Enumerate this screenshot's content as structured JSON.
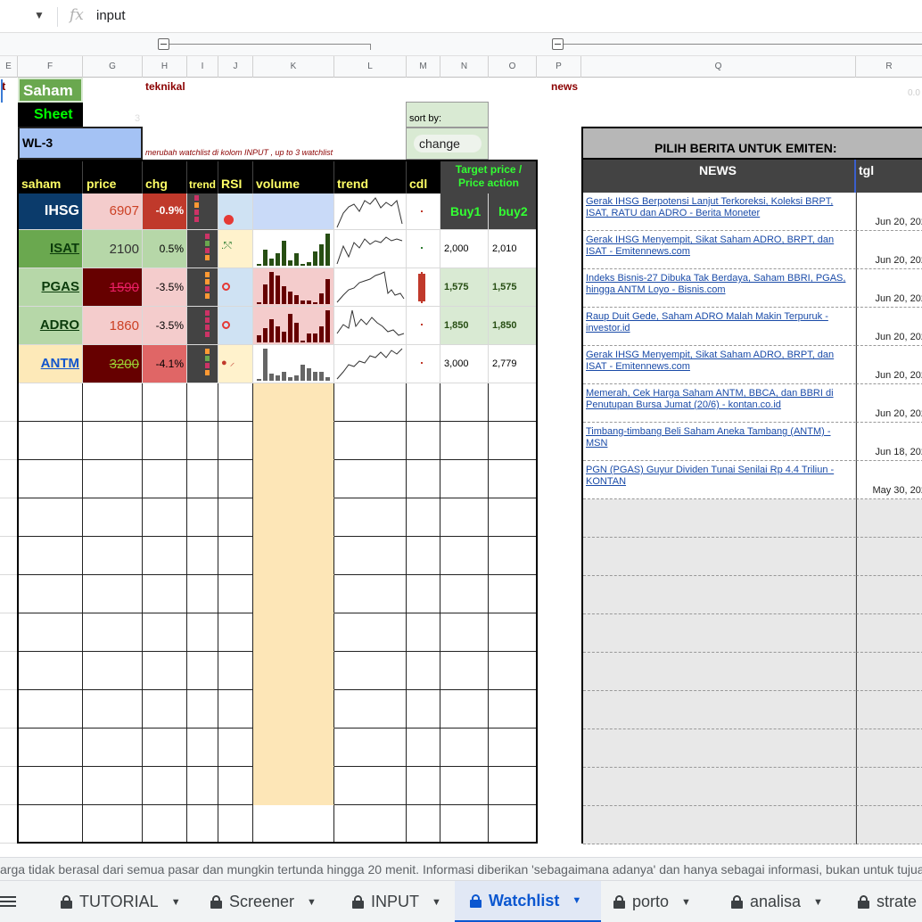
{
  "formula_bar": {
    "fx": "fx",
    "value": "input"
  },
  "columns": [
    "E",
    "F",
    "G",
    "H",
    "I",
    "J",
    "K",
    "L",
    "M",
    "N",
    "O",
    "P",
    "Q",
    "R"
  ],
  "sheet": {
    "corner_text": "t",
    "logo_line1": "Saham",
    "logo_line2": "Sheet",
    "stray_number": "3",
    "teknikal_label": "teknikal",
    "news_label": "news",
    "sort_by_label": "sort by:",
    "sort_value": "change",
    "watchlist_name": "WL-3",
    "watchlist_note": "merubah watchlist di kolom INPUT , up to 3 watchlist",
    "right_stray": "0.0",
    "headers": {
      "saham": "saham",
      "price": "price",
      "chg": "chg",
      "trend_small": "trend",
      "rsi": "RSI",
      "volume": "volume",
      "trend": "trend",
      "cdl": "cdl",
      "target": "Target price / Price action",
      "buy1": "Buy1",
      "buy2": "buy2"
    },
    "rows": [
      {
        "saham": "IHSG",
        "price": "6907",
        "chg": "-0.9%",
        "buy1": "",
        "buy2": "",
        "price_strike": false
      },
      {
        "saham": "ISAT",
        "price": "2100",
        "chg": "0.5%",
        "buy1": "2,000",
        "buy2": "2,010",
        "price_strike": false
      },
      {
        "saham": "PGAS",
        "price": "1590",
        "chg": "-3.5%",
        "buy1": "1,575",
        "buy2": "1,575",
        "price_strike": true
      },
      {
        "saham": "ADRO",
        "price": "1860",
        "chg": "-3.5%",
        "buy1": "1,850",
        "buy2": "1,850",
        "price_strike": false
      },
      {
        "saham": "ANTM",
        "price": "3200",
        "chg": "-4.1%",
        "buy1": "3,000",
        "buy2": "2,779",
        "price_strike": true
      }
    ]
  },
  "news_panel": {
    "title": "PILIH BERITA UNTUK EMITEN:",
    "col_news": "NEWS",
    "col_date": "tgl",
    "items": [
      {
        "text": "Gerak IHSG Berpotensi Lanjut Terkoreksi, Koleksi BRPT, ISAT, RATU dan ADRO - Berita Moneter",
        "date": "Jun 20, 202"
      },
      {
        "text": "Gerak IHSG Menyempit, Sikat Saham ADRO, BRPT, dan ISAT - Emitennews.com",
        "date": "Jun 20, 202"
      },
      {
        "text": "Indeks Bisnis-27 Dibuka Tak Berdaya, Saham BBRI, PGAS, hingga ANTM Loyo - Bisnis.com",
        "date": "Jun 20, 202"
      },
      {
        "text": "Raup Duit Gede, Saham ADRO Malah Makin Terpuruk - investor.id",
        "date": "Jun 20, 202"
      },
      {
        "text": "Gerak IHSG Menyempit, Sikat Saham ADRO, BRPT, dan ISAT - Emitennews.com",
        "date": "Jun 20, 202"
      },
      {
        "text": "Memerah, Cek Harga Saham ANTM, BBCA, dan BBRI di Penutupan Bursa Jumat (20/6) - kontan.co.id",
        "date": "Jun 20, 202"
      },
      {
        "text": "Timbang-timbang Beli Saham Aneka Tambang (ANTM) - MSN",
        "date": "Jun 18, 202"
      },
      {
        "text": "PGN (PGAS) Guyur Dividen Tunai Senilai Rp 4.4 Triliun - KONTAN",
        "date": "May 30, 202"
      }
    ]
  },
  "info_bar": "arga tidak berasal dari semua pasar dan mungkin tertunda hingga 20 menit. Informasi diberikan 'sebagaimana adanya' dan hanya sebagai informasi, bukan untuk tujuan p",
  "tabs": [
    {
      "label": "TUTORIAL",
      "active": false
    },
    {
      "label": "Screener",
      "active": false
    },
    {
      "label": "INPUT",
      "active": false
    },
    {
      "label": "Watchlist",
      "active": true
    },
    {
      "label": "porto",
      "active": false
    },
    {
      "label": "analisa",
      "active": false
    },
    {
      "label": "strate",
      "active": false
    }
  ],
  "colors": {
    "accent": "#0b57d0",
    "header_yellow": "#ffff66",
    "target_green": "#33ff33"
  }
}
